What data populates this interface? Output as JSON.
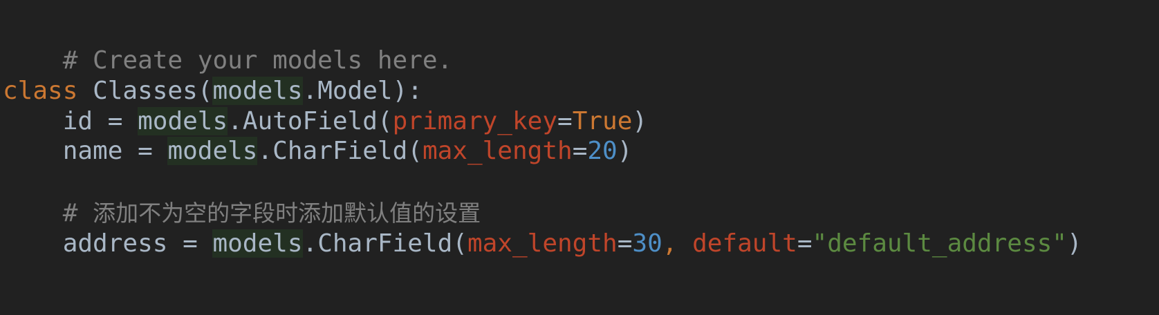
{
  "code": {
    "comment_create": "# Create your models here.",
    "class_keyword": "class",
    "class_name": "Classes",
    "models_module": "models",
    "base_class": "Model",
    "id_field": "id",
    "auto_field": "AutoField",
    "primary_key_arg": "primary_key",
    "true_value": "True",
    "name_field": "name",
    "char_field": "CharField",
    "max_length_arg": "max_length",
    "name_max_length": "20",
    "comment_zh_hash": "# ",
    "comment_zh_text": "添加不为空的字段时添加默认值的设置",
    "address_field": "address",
    "address_max_length": "30",
    "default_arg": "default",
    "default_value": "\"default_address\""
  },
  "colors": {
    "background": "#212121",
    "keyword": "#cc7832",
    "identifier": "#a9b7c6",
    "comment": "#808080",
    "kwarg": "#c0452a",
    "number": "#4e8fc7",
    "string": "#5c8a41",
    "module_highlight": "#233022"
  }
}
